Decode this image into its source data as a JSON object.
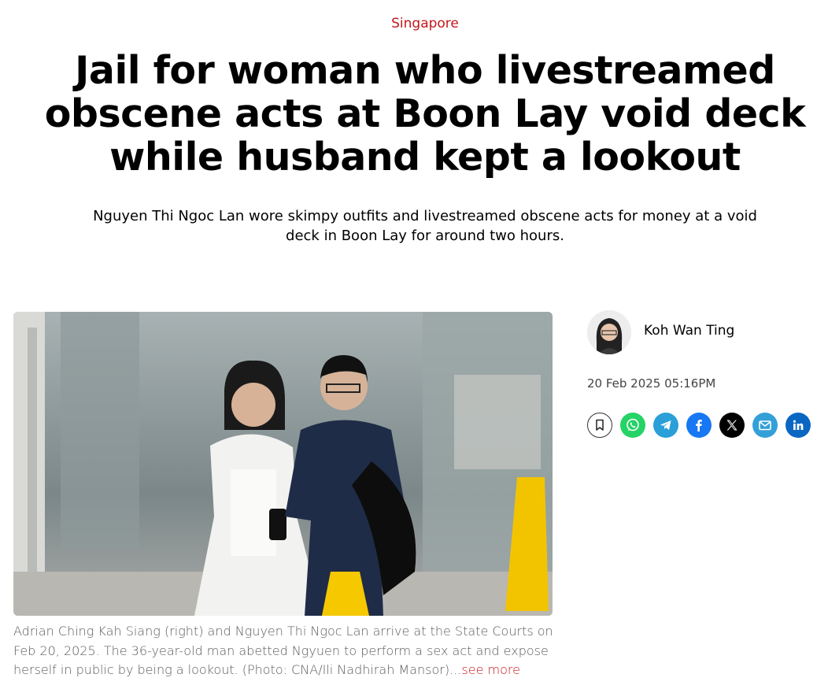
{
  "article": {
    "category": "Singapore",
    "headline": "Jail for woman who livestreamed obscene acts at Boon Lay void deck while husband kept a lookout",
    "standfirst": "Nguyen Thi Ngoc Lan wore skimpy outfits and livestreamed obscene acts for money at a void deck in Boon Lay for around two hours.",
    "caption": "Adrian Ching Kah Siang (right) and Nguyen Thi Ngoc Lan arrive at the State Courts on Feb 20, 2025. The 36-year-old man abetted Ngyuen to perform a sex act and expose herself in public by being a lookout. (Photo: CNA/Ili Nadhirah Mansor)...",
    "see_more": "see more"
  },
  "author": {
    "name": "Koh Wan Ting",
    "published": "20 Feb 2025 05:16PM"
  },
  "share": {
    "buttons": [
      {
        "name": "bookmark",
        "icon": "bookmark-icon",
        "color": "#ffffff"
      },
      {
        "name": "whatsapp",
        "icon": "whatsapp-icon",
        "color": "#25d366"
      },
      {
        "name": "telegram",
        "icon": "telegram-icon",
        "color": "#2a9fd8"
      },
      {
        "name": "facebook",
        "icon": "facebook-icon",
        "color": "#1877f2"
      },
      {
        "name": "x",
        "icon": "x-icon",
        "color": "#000000"
      },
      {
        "name": "email",
        "icon": "email-icon",
        "color": "#34a0d8"
      },
      {
        "name": "linkedin",
        "icon": "linkedin-icon",
        "color": "#0a66c2"
      }
    ]
  },
  "colors": {
    "accent": "#c4161c",
    "caption_text": "#5b5b5b"
  }
}
